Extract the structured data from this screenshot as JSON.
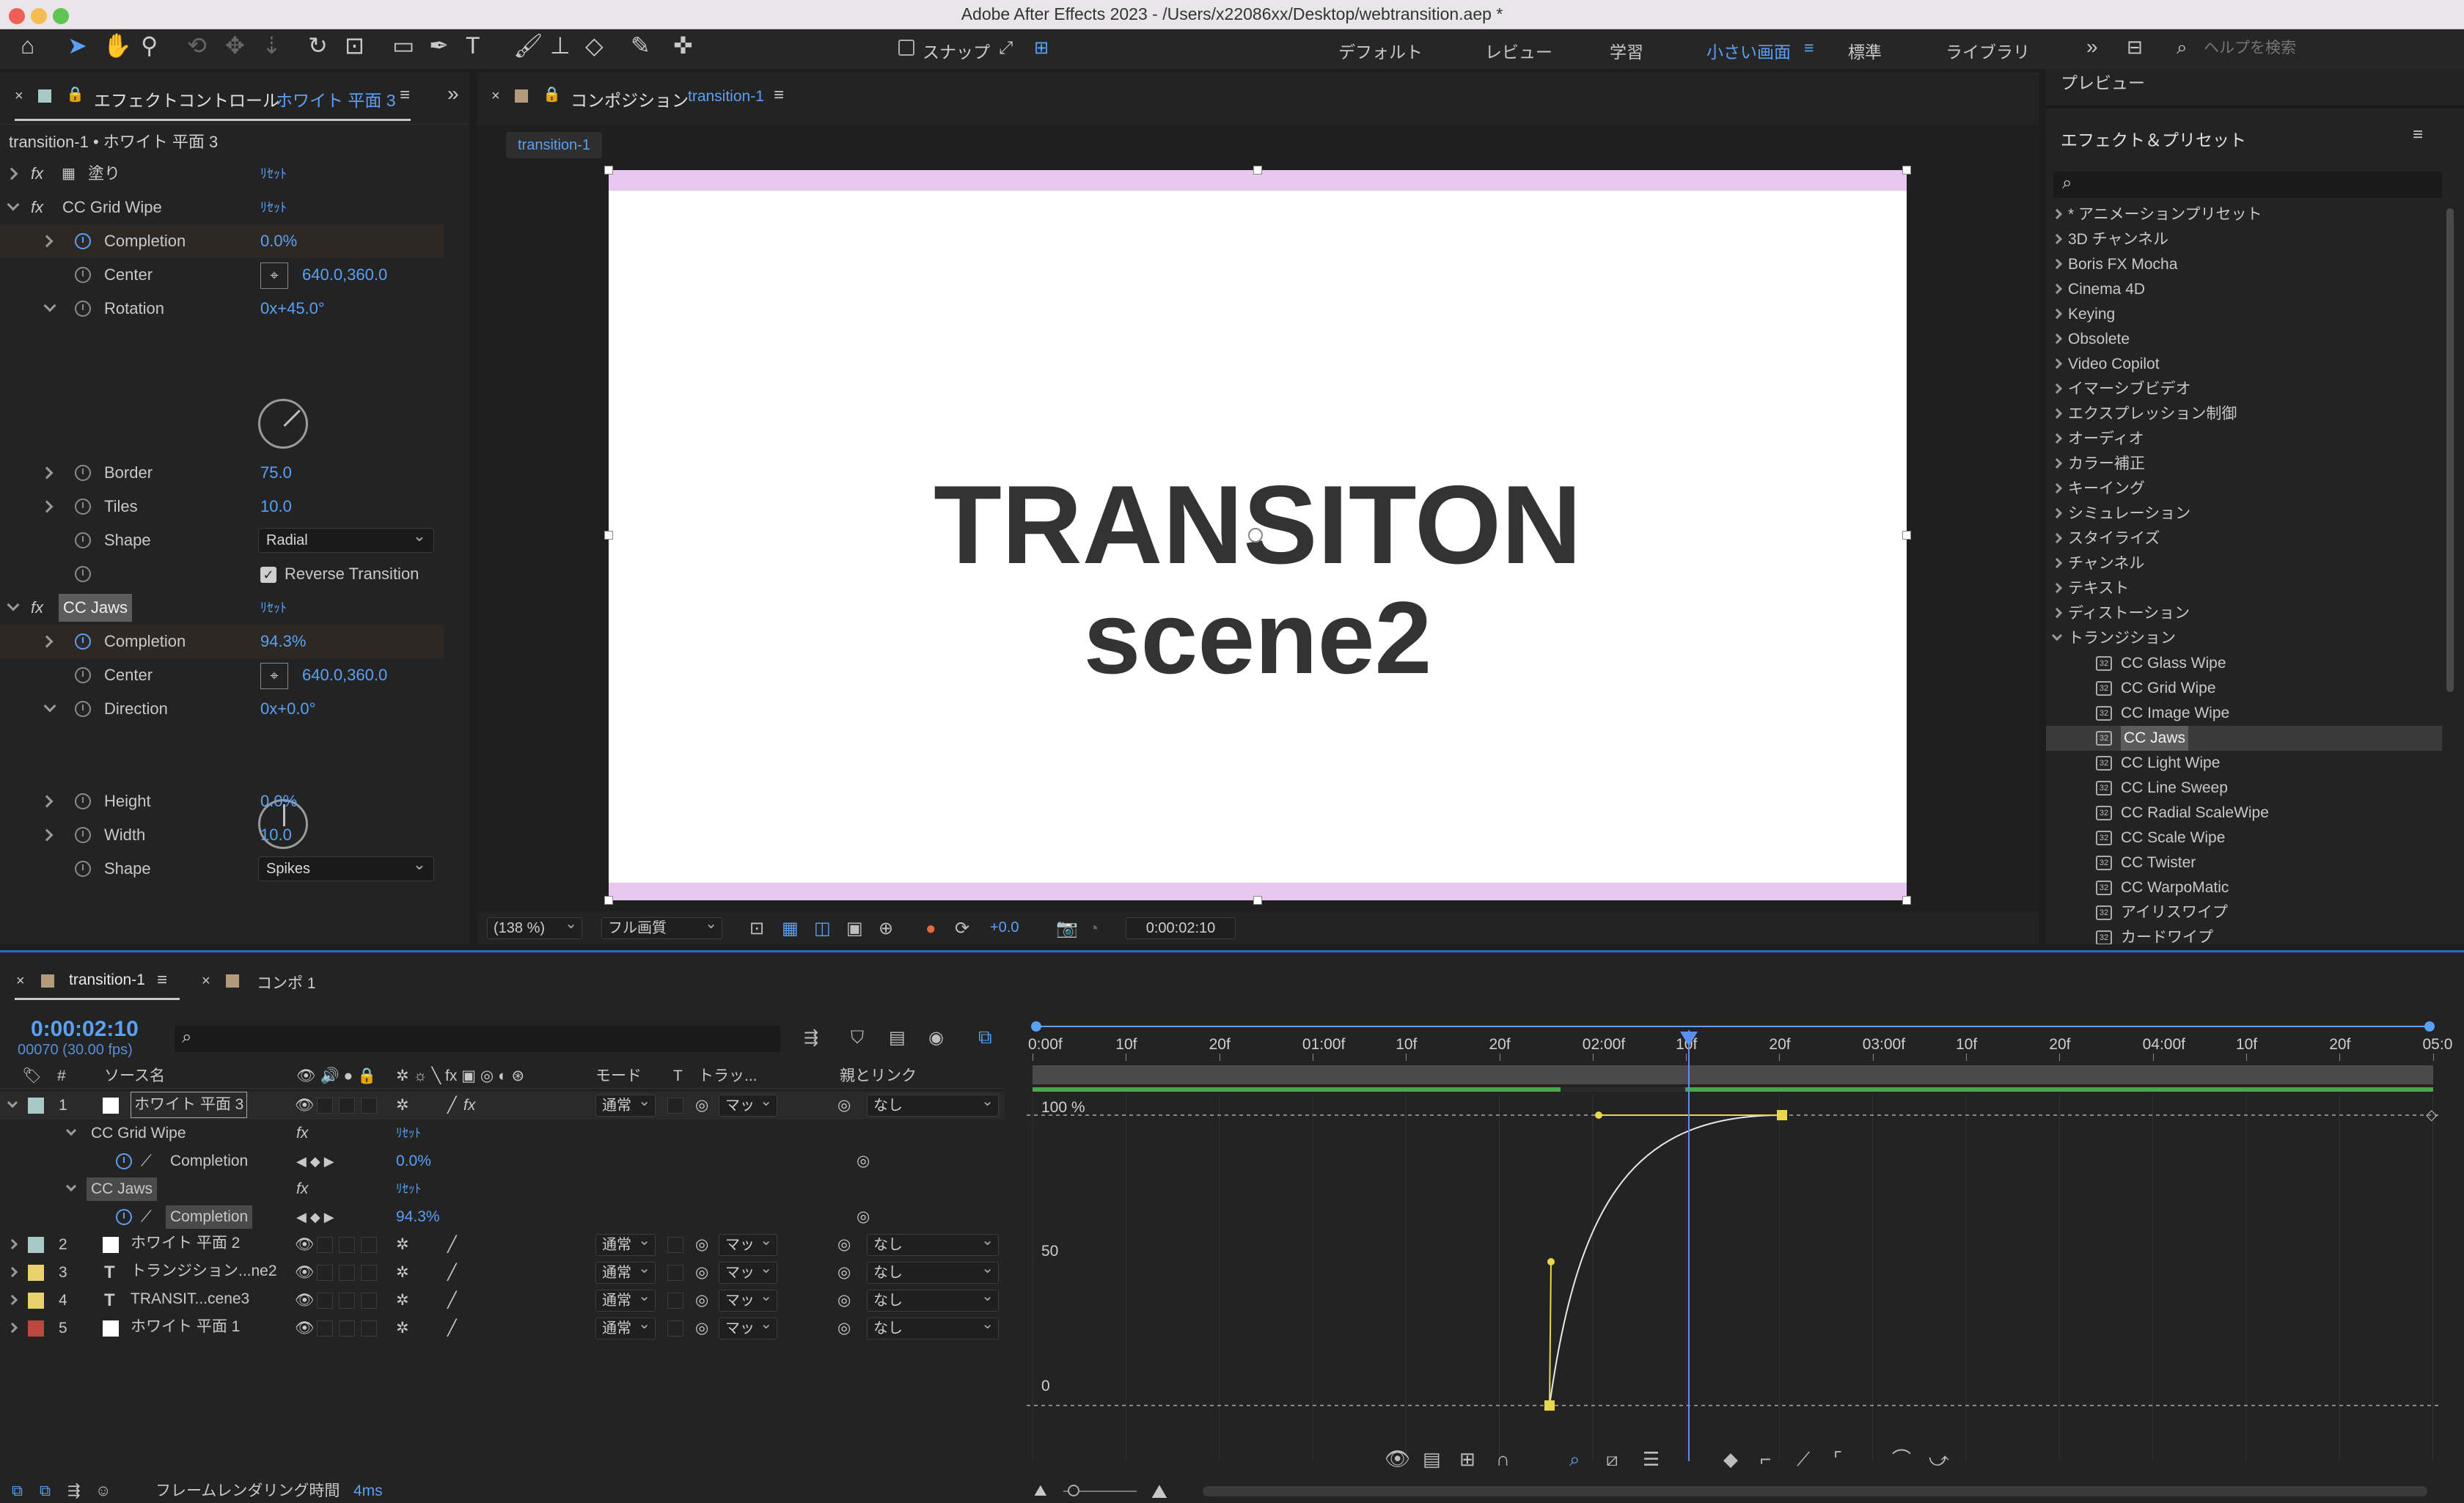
{
  "window": {
    "title": "Adobe After Effects 2023 - /Users/x22086xx/Desktop/webtransition.aep *"
  },
  "toolbar": {
    "snap_label": "スナップ",
    "workspaces": [
      "デフォルト",
      "レビュー",
      "学習",
      "小さい画面",
      "標準",
      "ライブラリ"
    ],
    "active_workspace": "小さい画面",
    "more": "»",
    "help_placeholder": "ヘルプを検索"
  },
  "effect_controls": {
    "tab_label": "エフェクトコントロール",
    "tab_layer": "ホワイト 平面 3",
    "breadcrumb": "transition-1 • ホワイト 平面 3",
    "reset": "ﾘｾｯﾄ",
    "fill_label": "塗り",
    "grid_wipe": {
      "name": "CC Grid Wipe",
      "completion_label": "Completion",
      "completion_value": "0.0%",
      "center_label": "Center",
      "center_value": "640.0,360.0",
      "rotation_label": "Rotation",
      "rotation_value": "0x+45.0°",
      "border_label": "Border",
      "border_value": "75.0",
      "tiles_label": "Tiles",
      "tiles_value": "10.0",
      "shape_label": "Shape",
      "shape_value": "Radial",
      "reverse_label": "Reverse Transition"
    },
    "jaws": {
      "name": "CC Jaws",
      "completion_label": "Completion",
      "completion_value": "94.3%",
      "center_label": "Center",
      "center_value": "640.0,360.0",
      "direction_label": "Direction",
      "direction_value": "0x+0.0°",
      "height_label": "Height",
      "height_value": "0.0%",
      "width_label": "Width",
      "width_value": "10.0",
      "shape_label": "Shape",
      "shape_value": "Spikes"
    }
  },
  "composition": {
    "tab_label": "コンポジション",
    "tab_comp": "transition-1",
    "sub_tab": "transition-1",
    "text_line1": "TRANSITON",
    "text_line2": "scene2",
    "zoom": "(138 %)",
    "quality": "フル画質",
    "exposure": "+0.0",
    "timecode": "0:00:02:10",
    "colors": {
      "band": "#e8c8ee",
      "canvas": "#ffffff",
      "text": "#333333"
    }
  },
  "presets": {
    "preview_label": "プレビュー",
    "title": "エフェクト＆プリセット",
    "search_placeholder": "",
    "categories": [
      "* アニメーションプリセット",
      "3D チャンネル",
      "Boris FX Mocha",
      "Cinema 4D",
      "Keying",
      "Obsolete",
      "Video Copilot",
      "イマーシブビデオ",
      "エクスプレッション制御",
      "オーディオ",
      "カラー補正",
      "キーイング",
      "シミュレーション",
      "スタイライズ",
      "チャンネル",
      "テキスト",
      "ディストーション",
      "トランジション"
    ],
    "transitions": [
      "CC Glass Wipe",
      "CC Grid Wipe",
      "CC Image Wipe",
      "CC Jaws",
      "CC Light Wipe",
      "CC Line Sweep",
      "CC Radial ScaleWipe",
      "CC Scale Wipe",
      "CC Twister",
      "CC WarpoMatic",
      "アイリスワイプ",
      "カードワイプ"
    ],
    "selected": "CC Jaws"
  },
  "timeline": {
    "tab_active": "transition-1",
    "tab_other": "コンポ 1",
    "timecode": "0:00:02:10",
    "frame_info": "00070 (30.00 fps)",
    "columns": {
      "num": "#",
      "source": "ソース名",
      "mode": "モード",
      "t": "T",
      "track": "トラッ...",
      "parent": "親とリンク"
    },
    "layers": [
      {
        "num": "1",
        "name": "ホワイト 平面 3",
        "type": "solid",
        "color": "#a9c9c9",
        "mode": "通常",
        "track": "マッ",
        "parent": "なし"
      },
      {
        "num": "2",
        "name": "ホワイト 平面 2",
        "type": "solid",
        "color": "#a9c9c9",
        "mode": "通常",
        "track": "マッ",
        "parent": "なし"
      },
      {
        "num": "3",
        "name": "トランジション...ne2",
        "type": "text",
        "color": "#e8d26a",
        "mode": "通常",
        "track": "マッ",
        "parent": "なし"
      },
      {
        "num": "4",
        "name": "TRANSIT...cene3",
        "type": "text",
        "color": "#e8d26a",
        "mode": "通常",
        "track": "マッ",
        "parent": "なし"
      },
      {
        "num": "5",
        "name": "ホワイト 平面 1",
        "type": "solid",
        "color": "#c0453e",
        "mode": "通常",
        "track": "マッ",
        "parent": "なし"
      }
    ],
    "sub": {
      "grid_wipe": "CC Grid Wipe",
      "grid_completion_label": "Completion",
      "grid_completion_value": "0.0%",
      "jaws": "CC Jaws",
      "jaws_completion_label": "Completion",
      "jaws_completion_value": "94.3%",
      "reset": "ﾘｾｯﾄ"
    },
    "ruler": [
      "0:00f",
      "10f",
      "20f",
      "01:00f",
      "10f",
      "20f",
      "02:00f",
      "10f",
      "20f",
      "03:00f",
      "10f",
      "20f",
      "04:00f",
      "10f",
      "20f",
      "05:0"
    ],
    "graph_labels": [
      "100 %",
      "50",
      "0"
    ],
    "render_time_label": "フレームレンダリング時間",
    "render_time_value": "4ms"
  }
}
